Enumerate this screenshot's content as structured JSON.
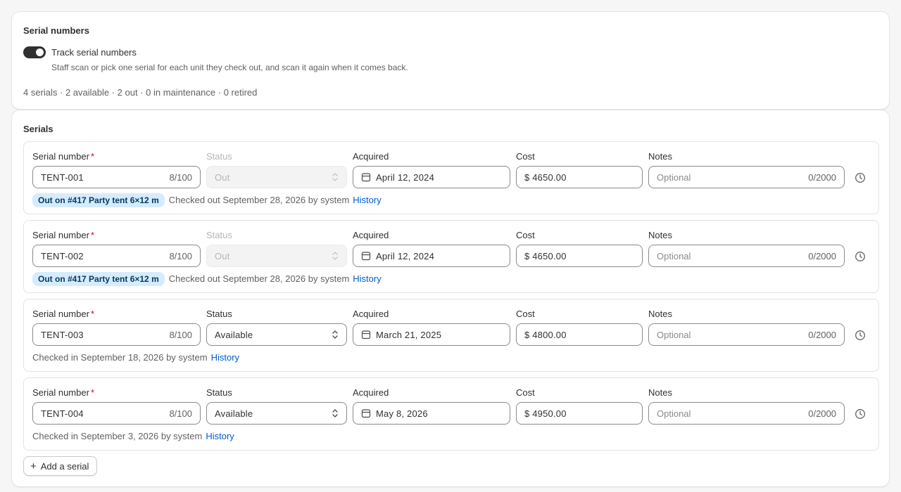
{
  "serial_numbers": {
    "title": "Serial numbers",
    "toggle_label": "Track serial numbers",
    "toggle_on": true,
    "help_text": "Staff scan or pick one serial for each unit they check out, and scan it again when it comes back.",
    "summary": "4 serials · 2 available · 2 out · 0 in maintenance · 0 retired"
  },
  "serials": {
    "title": "Serials",
    "labels": {
      "serial_number": "Serial number",
      "required_mark": "*",
      "status": "Status",
      "acquired": "Acquired",
      "cost": "Cost",
      "notes": "Notes"
    },
    "cost_prefix": "$",
    "notes_placeholder": "Optional",
    "history_link": "History",
    "rows": [
      {
        "serial": "TENT-001",
        "serial_count": "8/100",
        "status": "Out",
        "status_disabled": true,
        "acquired": "April 12, 2024",
        "cost": "4650.00",
        "notes_count": "0/2000",
        "badge": "Out on #417 Party tent 6×12 m",
        "meta": "Checked out September 28, 2026 by system"
      },
      {
        "serial": "TENT-002",
        "serial_count": "8/100",
        "status": "Out",
        "status_disabled": true,
        "acquired": "April 12, 2024",
        "cost": "4650.00",
        "notes_count": "0/2000",
        "badge": "Out on #417 Party tent 6×12 m",
        "meta": "Checked out September 28, 2026 by system"
      },
      {
        "serial": "TENT-003",
        "serial_count": "8/100",
        "status": "Available",
        "status_disabled": false,
        "acquired": "March 21, 2025",
        "cost": "4800.00",
        "notes_count": "0/2000",
        "badge": "",
        "meta": "Checked in September 18, 2026 by system"
      },
      {
        "serial": "TENT-004",
        "serial_count": "8/100",
        "status": "Available",
        "status_disabled": false,
        "acquired": "May 8, 2026",
        "cost": "4950.00",
        "notes_count": "0/2000",
        "badge": "",
        "meta": "Checked in September 3, 2026 by system"
      }
    ],
    "add_label": "Add a serial"
  }
}
